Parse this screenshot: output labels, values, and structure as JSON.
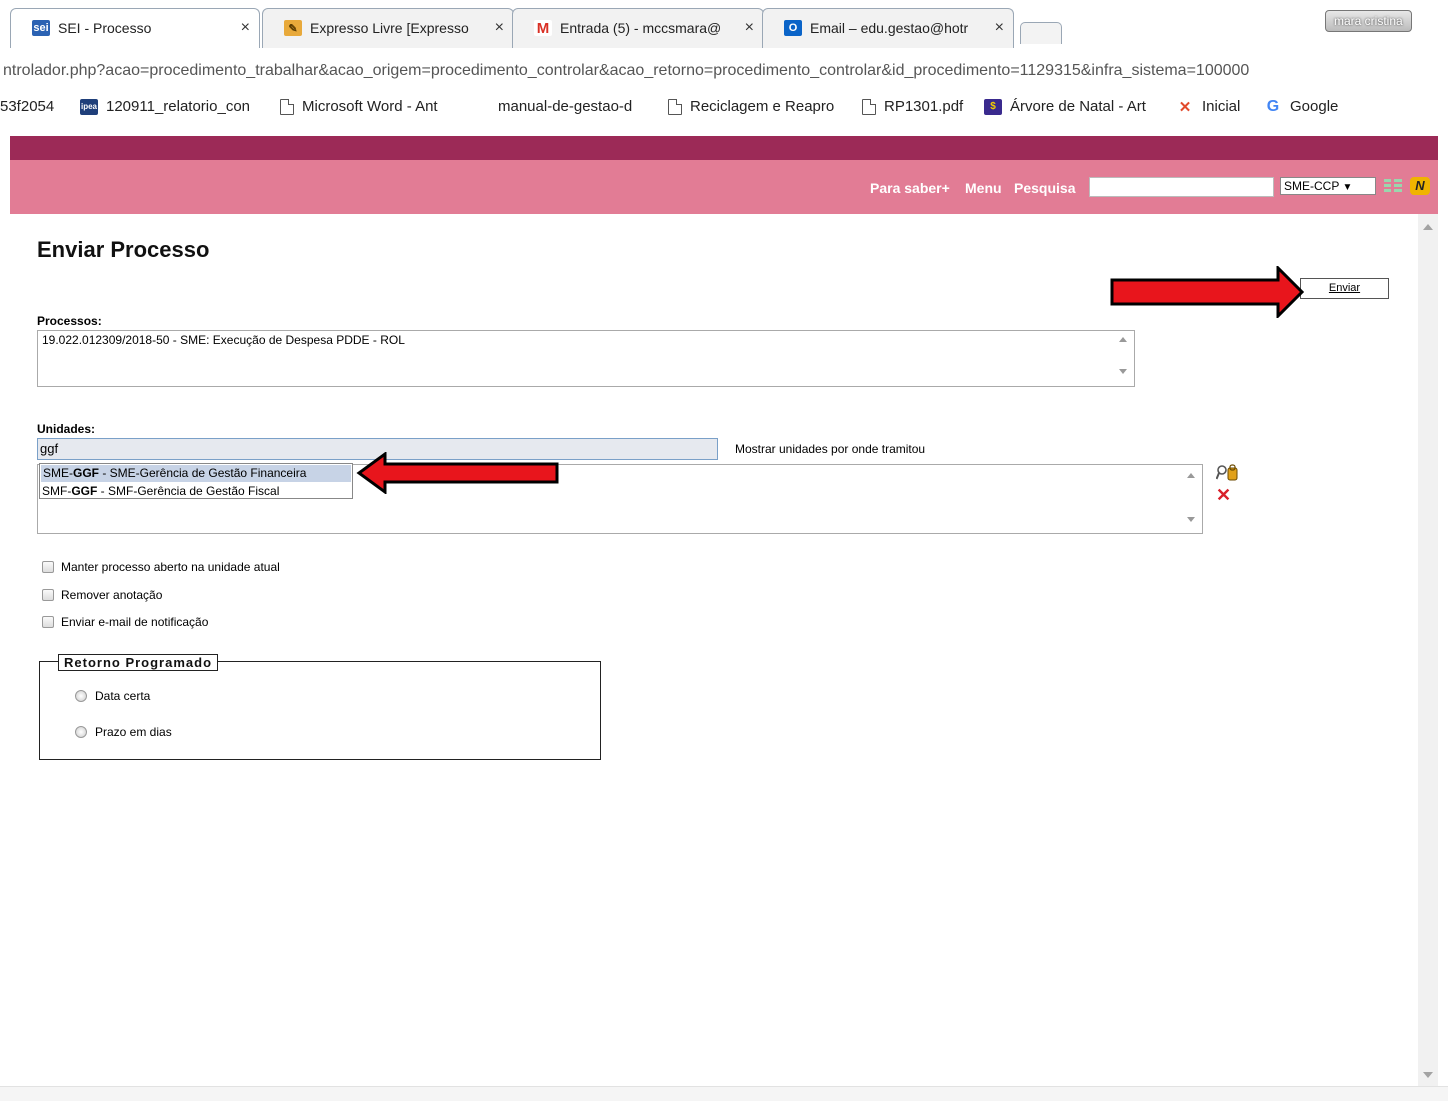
{
  "browser": {
    "tabs": [
      {
        "title": "SEI - Processo",
        "favicon": "sei",
        "close": "×",
        "active": true
      },
      {
        "title": "Expresso Livre [Expresso",
        "favicon": "expresso",
        "close": "×",
        "active": false
      },
      {
        "title": "Entrada (5) - mccsmara@",
        "favicon": "gmail",
        "close": "×",
        "active": false
      },
      {
        "title": "Email – edu.gestao@hotr",
        "favicon": "outlook",
        "close": "×",
        "active": false
      }
    ],
    "profile": "mara cristina",
    "url": "ntrolador.php?acao=procedimento_trabalhar&acao_origem=procedimento_controlar&acao_retorno=procedimento_controlar&id_procedimento=1129315&infra_sistema=100000",
    "bookmarks": [
      {
        "label": "53f2054",
        "icon": "none"
      },
      {
        "label": "120911_relatorio_con",
        "icon": "ipea"
      },
      {
        "label": "Microsoft Word - Ant",
        "icon": "page"
      },
      {
        "label": "manual-de-gestao-d",
        "icon": "none"
      },
      {
        "label": "Reciclagem e Reapro",
        "icon": "page"
      },
      {
        "label": "RP1301.pdf",
        "icon": "page"
      },
      {
        "label": "Árvore de Natal - Art",
        "icon": "dollar"
      },
      {
        "label": "Inicial",
        "icon": "joomla"
      },
      {
        "label": "Google",
        "icon": "google"
      }
    ]
  },
  "header": {
    "links": {
      "saber": "Para saber+",
      "menu": "Menu",
      "pesquisa": "Pesquisa"
    },
    "search_value": "",
    "unit_select": "SME-CCP",
    "colors": {
      "dark": "#9c2a57",
      "bar": "#e27c95"
    }
  },
  "page": {
    "title": "Enviar Processo",
    "enviar_button": "Enviar",
    "processos_label": "Processos:",
    "processo_item": "19.022.012309/2018-50 - SME: Execução de Despesa PDDE - ROL",
    "unidades_label": "Unidades:",
    "unidades_input": "ggf",
    "mostrar_link": "Mostrar unidades por onde tramitou",
    "autocomplete": [
      {
        "prefix": "SME-",
        "bold": "GGF",
        "suffix": " - SME-Gerência de Gestão Financeira",
        "selected": true
      },
      {
        "prefix": "SMF-",
        "bold": "GGF",
        "suffix": " - SMF-Gerência de Gestão Fiscal",
        "selected": false
      }
    ],
    "checkboxes": [
      "Manter processo aberto na unidade atual",
      "Remover anotação",
      "Enviar e-mail de notificação"
    ],
    "retorno": {
      "legend": "Retorno Programado",
      "options": [
        "Data certa",
        "Prazo em dias"
      ]
    }
  }
}
